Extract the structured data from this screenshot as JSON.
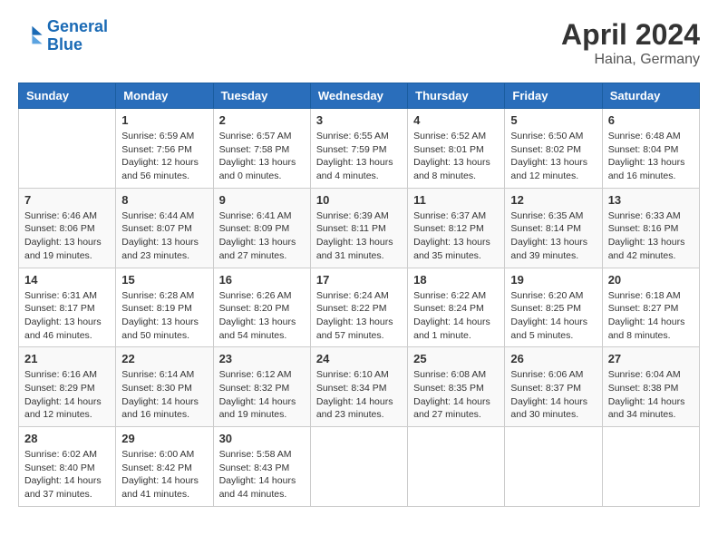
{
  "header": {
    "logo_line1": "General",
    "logo_line2": "Blue",
    "month": "April 2024",
    "location": "Haina, Germany"
  },
  "days_of_week": [
    "Sunday",
    "Monday",
    "Tuesday",
    "Wednesday",
    "Thursday",
    "Friday",
    "Saturday"
  ],
  "weeks": [
    [
      {
        "day": "",
        "info": ""
      },
      {
        "day": "1",
        "info": "Sunrise: 6:59 AM\nSunset: 7:56 PM\nDaylight: 12 hours\nand 56 minutes."
      },
      {
        "day": "2",
        "info": "Sunrise: 6:57 AM\nSunset: 7:58 PM\nDaylight: 13 hours\nand 0 minutes."
      },
      {
        "day": "3",
        "info": "Sunrise: 6:55 AM\nSunset: 7:59 PM\nDaylight: 13 hours\nand 4 minutes."
      },
      {
        "day": "4",
        "info": "Sunrise: 6:52 AM\nSunset: 8:01 PM\nDaylight: 13 hours\nand 8 minutes."
      },
      {
        "day": "5",
        "info": "Sunrise: 6:50 AM\nSunset: 8:02 PM\nDaylight: 13 hours\nand 12 minutes."
      },
      {
        "day": "6",
        "info": "Sunrise: 6:48 AM\nSunset: 8:04 PM\nDaylight: 13 hours\nand 16 minutes."
      }
    ],
    [
      {
        "day": "7",
        "info": "Sunrise: 6:46 AM\nSunset: 8:06 PM\nDaylight: 13 hours\nand 19 minutes."
      },
      {
        "day": "8",
        "info": "Sunrise: 6:44 AM\nSunset: 8:07 PM\nDaylight: 13 hours\nand 23 minutes."
      },
      {
        "day": "9",
        "info": "Sunrise: 6:41 AM\nSunset: 8:09 PM\nDaylight: 13 hours\nand 27 minutes."
      },
      {
        "day": "10",
        "info": "Sunrise: 6:39 AM\nSunset: 8:11 PM\nDaylight: 13 hours\nand 31 minutes."
      },
      {
        "day": "11",
        "info": "Sunrise: 6:37 AM\nSunset: 8:12 PM\nDaylight: 13 hours\nand 35 minutes."
      },
      {
        "day": "12",
        "info": "Sunrise: 6:35 AM\nSunset: 8:14 PM\nDaylight: 13 hours\nand 39 minutes."
      },
      {
        "day": "13",
        "info": "Sunrise: 6:33 AM\nSunset: 8:16 PM\nDaylight: 13 hours\nand 42 minutes."
      }
    ],
    [
      {
        "day": "14",
        "info": "Sunrise: 6:31 AM\nSunset: 8:17 PM\nDaylight: 13 hours\nand 46 minutes."
      },
      {
        "day": "15",
        "info": "Sunrise: 6:28 AM\nSunset: 8:19 PM\nDaylight: 13 hours\nand 50 minutes."
      },
      {
        "day": "16",
        "info": "Sunrise: 6:26 AM\nSunset: 8:20 PM\nDaylight: 13 hours\nand 54 minutes."
      },
      {
        "day": "17",
        "info": "Sunrise: 6:24 AM\nSunset: 8:22 PM\nDaylight: 13 hours\nand 57 minutes."
      },
      {
        "day": "18",
        "info": "Sunrise: 6:22 AM\nSunset: 8:24 PM\nDaylight: 14 hours\nand 1 minute."
      },
      {
        "day": "19",
        "info": "Sunrise: 6:20 AM\nSunset: 8:25 PM\nDaylight: 14 hours\nand 5 minutes."
      },
      {
        "day": "20",
        "info": "Sunrise: 6:18 AM\nSunset: 8:27 PM\nDaylight: 14 hours\nand 8 minutes."
      }
    ],
    [
      {
        "day": "21",
        "info": "Sunrise: 6:16 AM\nSunset: 8:29 PM\nDaylight: 14 hours\nand 12 minutes."
      },
      {
        "day": "22",
        "info": "Sunrise: 6:14 AM\nSunset: 8:30 PM\nDaylight: 14 hours\nand 16 minutes."
      },
      {
        "day": "23",
        "info": "Sunrise: 6:12 AM\nSunset: 8:32 PM\nDaylight: 14 hours\nand 19 minutes."
      },
      {
        "day": "24",
        "info": "Sunrise: 6:10 AM\nSunset: 8:34 PM\nDaylight: 14 hours\nand 23 minutes."
      },
      {
        "day": "25",
        "info": "Sunrise: 6:08 AM\nSunset: 8:35 PM\nDaylight: 14 hours\nand 27 minutes."
      },
      {
        "day": "26",
        "info": "Sunrise: 6:06 AM\nSunset: 8:37 PM\nDaylight: 14 hours\nand 30 minutes."
      },
      {
        "day": "27",
        "info": "Sunrise: 6:04 AM\nSunset: 8:38 PM\nDaylight: 14 hours\nand 34 minutes."
      }
    ],
    [
      {
        "day": "28",
        "info": "Sunrise: 6:02 AM\nSunset: 8:40 PM\nDaylight: 14 hours\nand 37 minutes."
      },
      {
        "day": "29",
        "info": "Sunrise: 6:00 AM\nSunset: 8:42 PM\nDaylight: 14 hours\nand 41 minutes."
      },
      {
        "day": "30",
        "info": "Sunrise: 5:58 AM\nSunset: 8:43 PM\nDaylight: 14 hours\nand 44 minutes."
      },
      {
        "day": "",
        "info": ""
      },
      {
        "day": "",
        "info": ""
      },
      {
        "day": "",
        "info": ""
      },
      {
        "day": "",
        "info": ""
      }
    ]
  ]
}
